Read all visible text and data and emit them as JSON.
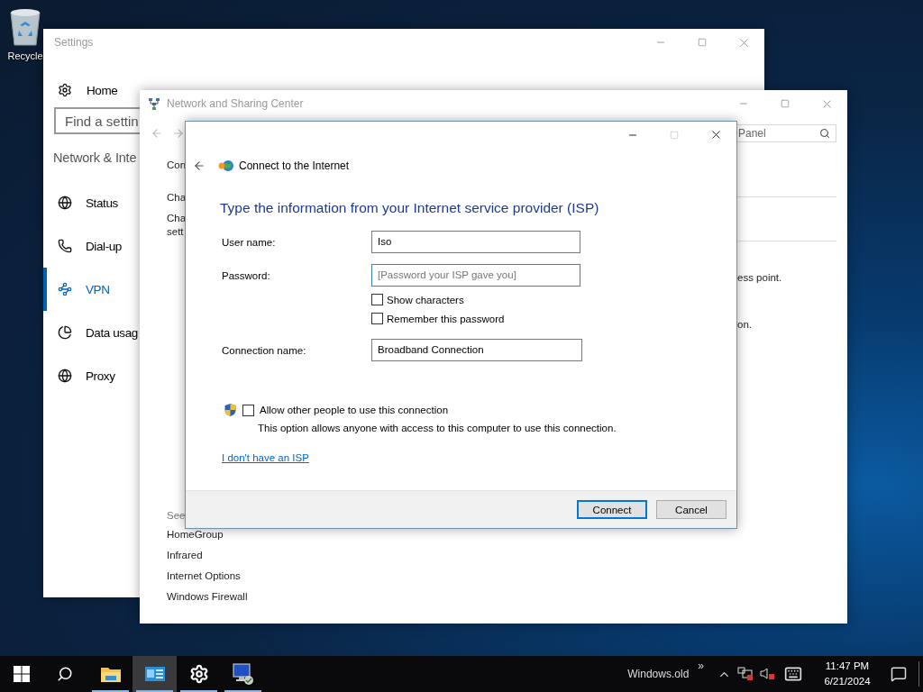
{
  "desktop": {
    "icons": [
      {
        "label": "Recycle"
      }
    ]
  },
  "settings_window": {
    "title": "Settings",
    "home": "Home",
    "search": {
      "placeholder": "Find a settin"
    },
    "section_title": "Network & Inte",
    "nav": [
      {
        "kind": "status",
        "label": "Status",
        "selected": false
      },
      {
        "kind": "dialup",
        "label": "Dial-up",
        "selected": false
      },
      {
        "kind": "vpn",
        "label": "VPN",
        "selected": true
      },
      {
        "kind": "data",
        "label": "Data usag",
        "selected": false
      },
      {
        "kind": "proxy",
        "label": "Proxy",
        "selected": false
      }
    ]
  },
  "network_window": {
    "title": "Network and Sharing Center",
    "search": {
      "placeholder": "Panel"
    },
    "left_links": [
      "Con",
      "Cha",
      "Cha\nsett"
    ],
    "right_texts": [
      "ess point.",
      "on."
    ],
    "see_also": {
      "title": "See",
      "links": [
        "HomeGroup",
        "Infrared",
        "Internet Options",
        "Windows Firewall"
      ]
    }
  },
  "dialog": {
    "title": "Connect to the Internet",
    "heading": "Type the information from your Internet service provider (ISP)",
    "user_name": {
      "label": "User name:",
      "value": "Iso",
      "focused": false
    },
    "password": {
      "label": "Password:",
      "placeholder": "[Password your ISP gave you]",
      "focused": true
    },
    "options": [
      {
        "label": "Show characters",
        "checked": false
      },
      {
        "label": "Remember this password",
        "checked": false
      }
    ],
    "connection_name": {
      "label": "Connection name:",
      "value": "Broadband Connection",
      "focused": false
    },
    "allow_others": {
      "label": "Allow other people to use this connection",
      "checked": false,
      "description": "This option allows anyone with access to this computer to use this connection."
    },
    "link": "I don't have an ISP",
    "buttons": [
      {
        "label": "Connect",
        "default": true
      },
      {
        "label": "Cancel",
        "default": false
      }
    ]
  },
  "taskbar": {
    "apps": [
      {
        "kind": "explorer",
        "selected": false,
        "running": true
      },
      {
        "kind": "control-panel",
        "selected": true,
        "running": true
      },
      {
        "kind": "settings",
        "selected": false,
        "running": true
      },
      {
        "kind": "network",
        "selected": false,
        "running": true
      }
    ],
    "toolbar": "Windows.old",
    "toolbar_more": "»",
    "clock": {
      "time": "11:47 PM",
      "date": "6/21/2024"
    }
  }
}
